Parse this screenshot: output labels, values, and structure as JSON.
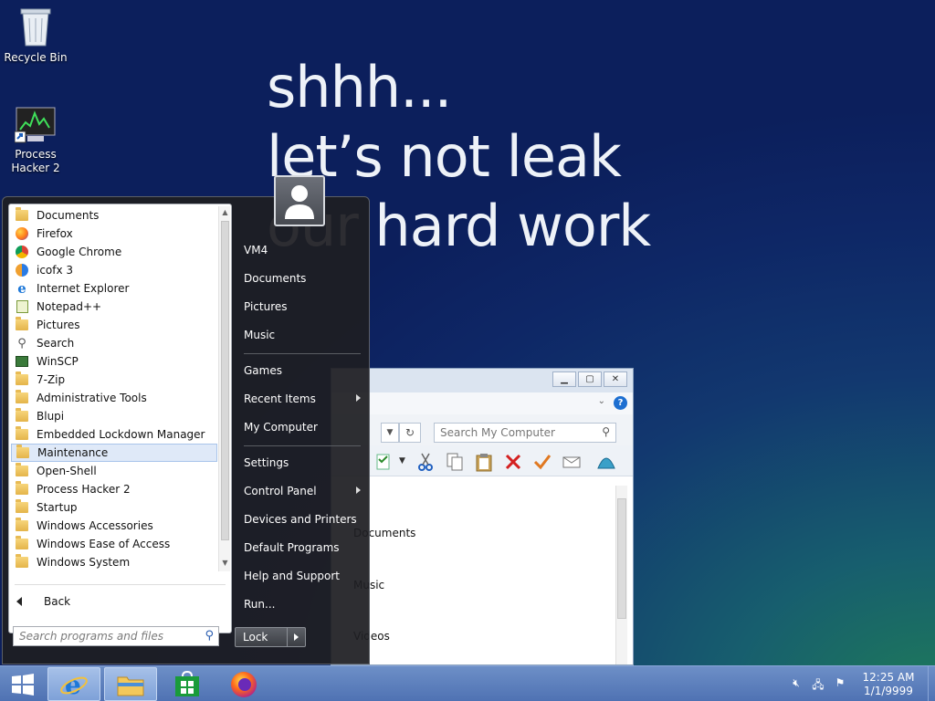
{
  "wallpaper": {
    "lines": [
      "shhh...",
      "let’s not leak",
      "our hard work"
    ]
  },
  "desktop": {
    "icons": [
      {
        "label": "Recycle Bin",
        "icon": "recycle-bin-icon"
      },
      {
        "label": "Process Hacker 2",
        "icon": "process-hacker-icon"
      }
    ]
  },
  "start_menu": {
    "programs": [
      {
        "label": "Documents",
        "icon": "documents-icon"
      },
      {
        "label": "Firefox",
        "icon": "firefox-icon"
      },
      {
        "label": "Google Chrome",
        "icon": "chrome-icon"
      },
      {
        "label": "icofx 3",
        "icon": "icofx-icon"
      },
      {
        "label": "Internet Explorer",
        "icon": "ie-icon"
      },
      {
        "label": "Notepad++",
        "icon": "notepadpp-icon"
      },
      {
        "label": "Pictures",
        "icon": "pictures-icon"
      },
      {
        "label": "Search",
        "icon": "search-icon"
      },
      {
        "label": "WinSCP",
        "icon": "winscp-icon"
      },
      {
        "label": "7-Zip",
        "icon": "folder-icon"
      },
      {
        "label": "Administrative Tools",
        "icon": "folder-icon"
      },
      {
        "label": "Blupi",
        "icon": "folder-icon"
      },
      {
        "label": "Embedded Lockdown Manager",
        "icon": "folder-icon"
      },
      {
        "label": "Maintenance",
        "icon": "folder-icon",
        "selected": true
      },
      {
        "label": "Open-Shell",
        "icon": "folder-icon"
      },
      {
        "label": "Process Hacker 2",
        "icon": "folder-icon"
      },
      {
        "label": "Startup",
        "icon": "folder-icon"
      },
      {
        "label": "Windows Accessories",
        "icon": "folder-icon"
      },
      {
        "label": "Windows Ease of Access",
        "icon": "folder-icon"
      },
      {
        "label": "Windows System",
        "icon": "folder-icon"
      }
    ],
    "back_label": "Back",
    "search_placeholder": "Search programs and files",
    "right_items": {
      "user": "VM4",
      "documents": "Documents",
      "pictures": "Pictures",
      "music": "Music",
      "games": "Games",
      "recent": "Recent Items",
      "computer": "My Computer",
      "settings": "Settings",
      "control_panel": "Control Panel",
      "devices": "Devices and Printers",
      "default_programs": "Default Programs",
      "help": "Help and Support",
      "run": "Run..."
    },
    "lock_label": "Lock"
  },
  "explorer": {
    "search_placeholder": "Search My Computer",
    "items": [
      "Documents",
      "Music",
      "Videos"
    ]
  },
  "taskbar": {
    "time": "12:25 AM",
    "date": "1/1/9999",
    "pinned": [
      "ie-icon",
      "file-explorer-icon",
      "store-icon",
      "firefox-icon"
    ]
  },
  "colors": {
    "taskbar": "#5a7dbc",
    "selection": "#dfe9f8",
    "startmenu_bg": "#1e1e22"
  }
}
